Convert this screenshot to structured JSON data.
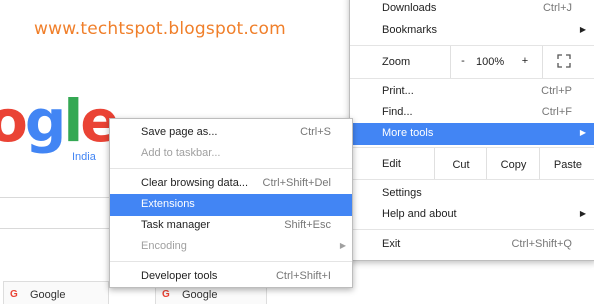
{
  "watermark": {
    "text": "www.techtspot.blogspot.com",
    "color": "#f07f2a"
  },
  "logo": {
    "letters": [
      "o",
      "g",
      "l",
      "e"
    ],
    "colors": [
      "#ea4335",
      "#4285f4",
      "#34a853",
      "#ea4335"
    ],
    "country": "India",
    "country_color": "#4285f4"
  },
  "tiles": [
    {
      "favicon": "G",
      "label": "Google"
    },
    {
      "favicon": "G",
      "label": "Google"
    }
  ],
  "main_menu": {
    "downloads": {
      "label": "Downloads",
      "shortcut": "Ctrl+J"
    },
    "bookmarks": {
      "label": "Bookmarks"
    },
    "zoom": {
      "label": "Zoom",
      "minus": "-",
      "level": "100%",
      "plus": "+",
      "fullscreen_icon": "fullscreen-icon"
    },
    "print": {
      "label": "Print...",
      "shortcut": "Ctrl+P"
    },
    "find": {
      "label": "Find...",
      "shortcut": "Ctrl+F"
    },
    "more_tools": {
      "label": "More tools"
    },
    "edit": {
      "label": "Edit",
      "cut": "Cut",
      "copy": "Copy",
      "paste": "Paste"
    },
    "settings": {
      "label": "Settings"
    },
    "help": {
      "label": "Help and about"
    },
    "exit": {
      "label": "Exit",
      "shortcut": "Ctrl+Shift+Q"
    }
  },
  "sub_menu": {
    "save_page": {
      "label": "Save page as...",
      "shortcut": "Ctrl+S"
    },
    "add_taskbar": {
      "label": "Add to taskbar..."
    },
    "clear_data": {
      "label": "Clear browsing data...",
      "shortcut": "Ctrl+Shift+Del"
    },
    "extensions": {
      "label": "Extensions"
    },
    "task_manager": {
      "label": "Task manager",
      "shortcut": "Shift+Esc"
    },
    "encoding": {
      "label": "Encoding"
    },
    "dev_tools": {
      "label": "Developer tools",
      "shortcut": "Ctrl+Shift+I"
    }
  },
  "colors": {
    "highlight": "#4285f4"
  }
}
